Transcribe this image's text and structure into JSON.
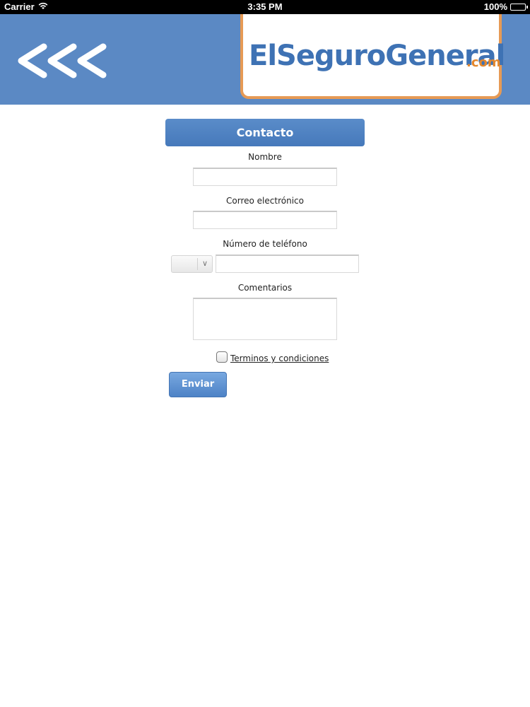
{
  "status_bar": {
    "carrier": "Carrier",
    "time": "3:35 PM",
    "battery": "100%",
    "wifi_icon": "wifi-icon",
    "battery_icon": "battery-icon"
  },
  "header": {
    "back_icon": "triple-chevron-left-icon",
    "logo_main": "ElSeguroGeneral",
    "logo_suffix": ".com",
    "background_color": "#5b89c4",
    "logo_border_color": "#e69a55"
  },
  "form": {
    "title": "Contacto",
    "name_label": "Nombre",
    "name_value": "",
    "email_label": "Correo electrónico",
    "email_value": "",
    "phone_label": "Número de teléfono",
    "phone_prefix_value": "",
    "phone_value": "",
    "comments_label": "Comentarios",
    "comments_value": "",
    "terms_label": "Terminos y condiciones",
    "terms_checked": false,
    "submit_label": "Enviar",
    "accent_color": "#4d82c6"
  }
}
